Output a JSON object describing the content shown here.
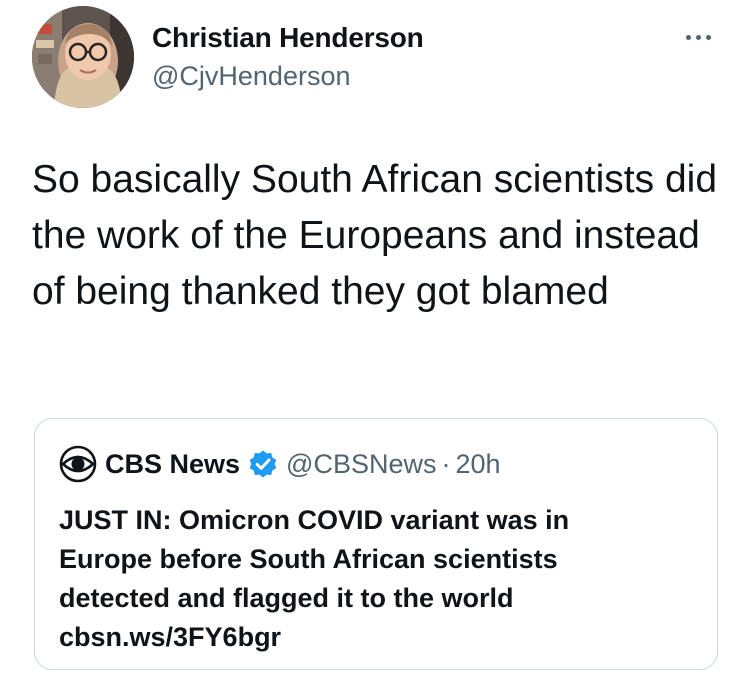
{
  "tweet": {
    "author": {
      "name": "Christian Henderson",
      "handle": "@CjvHenderson",
      "avatar_icon": "profile-photo"
    },
    "more_icon": "more-horizontal-icon",
    "text": "So basically South African scientists did the work of the Europeans and instead of being thanked they got blamed"
  },
  "quoted_tweet": {
    "logo_icon": "cbs-eye-logo",
    "name": "CBS News",
    "verified_icon": "verified-badge-icon",
    "handle": "@CBSNews",
    "separator": "·",
    "time": "20h",
    "text_lines": [
      "JUST IN: Omicron COVID variant was in",
      "Europe before South African scientists",
      "detected and flagged it to the world",
      "cbsn.ws/3FY6bgr"
    ]
  },
  "colors": {
    "text_primary": "#0f1419",
    "text_secondary": "#536471",
    "verified_blue": "#1d9bf0",
    "border": "#cfd9de"
  }
}
